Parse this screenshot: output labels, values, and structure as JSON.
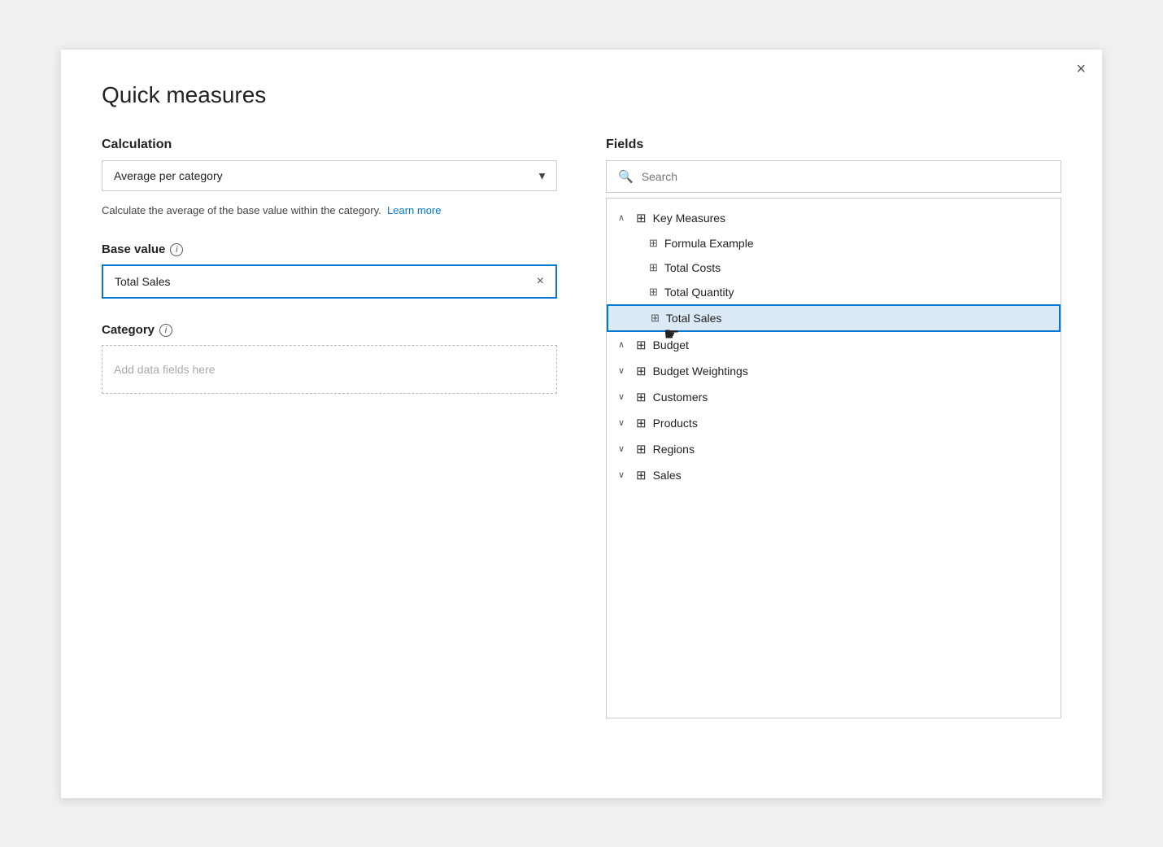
{
  "dialog": {
    "title": "Quick measures",
    "close_label": "×"
  },
  "left": {
    "calculation_label": "Calculation",
    "calculation_value": "Average per category",
    "dropdown_arrow": "▼",
    "description": "Calculate the average of the base value within the category.",
    "learn_more": "Learn more",
    "base_value_label": "Base value",
    "base_value_value": "Total Sales",
    "clear_icon": "×",
    "category_label": "Category",
    "category_placeholder": "Add data fields here"
  },
  "right": {
    "fields_label": "Fields",
    "search_placeholder": "Search",
    "tree": [
      {
        "id": "key-measures",
        "type": "group",
        "expanded": true,
        "label": "Key Measures",
        "icon": "measure",
        "indent": 0
      },
      {
        "id": "formula-example",
        "type": "child",
        "label": "Formula Example",
        "icon": "measure",
        "indent": 1
      },
      {
        "id": "total-costs",
        "type": "child",
        "label": "Total Costs",
        "icon": "measure",
        "indent": 1
      },
      {
        "id": "total-quantity",
        "type": "child",
        "label": "Total Quantity",
        "icon": "measure",
        "indent": 1
      },
      {
        "id": "total-sales",
        "type": "child",
        "label": "Total Sales",
        "icon": "measure",
        "indent": 1,
        "highlighted": true
      },
      {
        "id": "budget",
        "type": "group",
        "expanded": true,
        "label": "Budget",
        "icon": "table",
        "indent": 0,
        "partial": true
      },
      {
        "id": "budget-weightings",
        "type": "group",
        "expanded": false,
        "label": "Budget Weightings",
        "icon": "table",
        "indent": 0
      },
      {
        "id": "customers",
        "type": "group",
        "expanded": false,
        "label": "Customers",
        "icon": "table",
        "indent": 0
      },
      {
        "id": "products",
        "type": "group",
        "expanded": false,
        "label": "Products",
        "icon": "table",
        "indent": 0
      },
      {
        "id": "regions",
        "type": "group",
        "expanded": false,
        "label": "Regions",
        "icon": "table",
        "indent": 0
      },
      {
        "id": "sales",
        "type": "group",
        "expanded": false,
        "label": "Sales",
        "icon": "table",
        "indent": 0
      }
    ]
  }
}
